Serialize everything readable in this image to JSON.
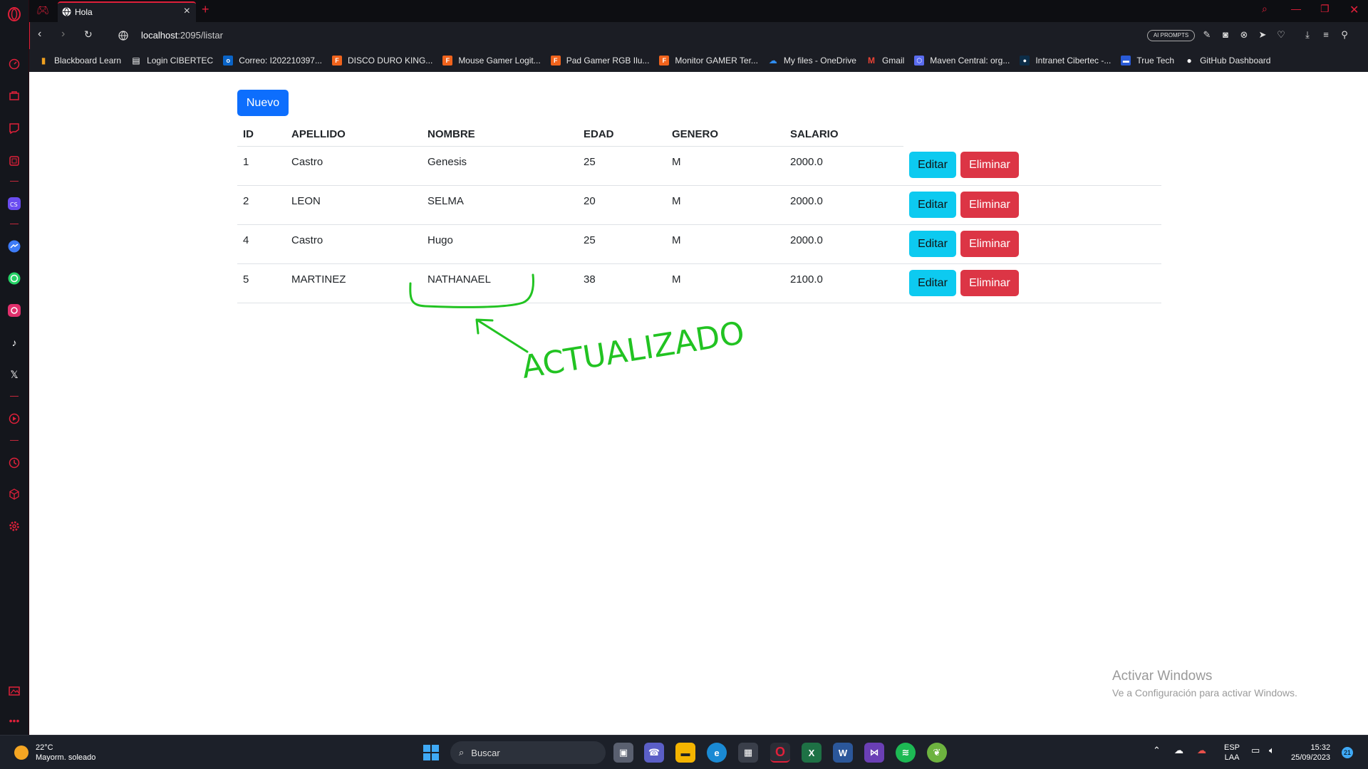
{
  "browser": {
    "tab_title": "Hola",
    "url_host": "localhost",
    "url_path": ":2095/listar",
    "ai_prompts_label": "AI PROMPTS",
    "accent_color": "#e0203a"
  },
  "bookmarks": [
    {
      "label": "Blackboard Learn",
      "icon": "bar-chart-icon",
      "color": "#f0a020"
    },
    {
      "label": "Login CIBERTEC",
      "icon": "document-icon",
      "color": "#ffffff"
    },
    {
      "label": "Correo: I202210397...",
      "icon": "outlook-icon",
      "color": "#0a64c8"
    },
    {
      "label": "DISCO DURO KING...",
      "icon": "falabella-icon",
      "color": "#f0631c"
    },
    {
      "label": "Mouse Gamer Logit...",
      "icon": "falabella-icon",
      "color": "#f0631c"
    },
    {
      "label": "Pad Gamer RGB Ilu...",
      "icon": "falabella-icon",
      "color": "#f0631c"
    },
    {
      "label": "Monitor GAMER Ter...",
      "icon": "falabella-icon",
      "color": "#f0631c"
    },
    {
      "label": "My files - OneDrive",
      "icon": "onedrive-icon",
      "color": "#2f8cf0"
    },
    {
      "label": "Gmail",
      "icon": "gmail-icon",
      "color": "#ea4335"
    },
    {
      "label": "Maven Central: org...",
      "icon": "maven-icon",
      "color": "#5a6cf0"
    },
    {
      "label": "Intranet Cibertec -...",
      "icon": "intranet-icon",
      "color": "#0c2d48"
    },
    {
      "label": "True Tech",
      "icon": "truetech-icon",
      "color": "#2a5bd7"
    },
    {
      "label": "GitHub Dashboard",
      "icon": "github-icon",
      "color": "#ffffff"
    }
  ],
  "page": {
    "new_button": "Nuevo",
    "columns": [
      "ID",
      "APELLIDO",
      "NOMBRE",
      "EDAD",
      "GENERO",
      "SALARIO"
    ],
    "rows": [
      {
        "id": "1",
        "apellido": "Castro",
        "nombre": "Genesis",
        "edad": "25",
        "genero": "M",
        "salario": "2000.0"
      },
      {
        "id": "2",
        "apellido": "LEON",
        "nombre": "SELMA",
        "edad": "20",
        "genero": "M",
        "salario": "2000.0"
      },
      {
        "id": "4",
        "apellido": "Castro",
        "nombre": "Hugo",
        "edad": "25",
        "genero": "M",
        "salario": "2000.0"
      },
      {
        "id": "5",
        "apellido": "MARTINEZ",
        "nombre": "NATHANAEL",
        "edad": "38",
        "genero": "M",
        "salario": "2100.0"
      }
    ],
    "edit_label": "Editar",
    "delete_label": "Eliminar",
    "annotation_text": "ACTUALIZADO",
    "annotation_color": "#22c322"
  },
  "watermark": {
    "title": "Activar Windows",
    "subtitle": "Ve a Configuración para activar Windows."
  },
  "taskbar": {
    "temperature": "22°C",
    "weather": "Mayorm. soleado",
    "search_placeholder": "Buscar",
    "lang_top": "ESP",
    "lang_bottom": "LAA",
    "time": "15:32",
    "date": "25/09/2023",
    "notifications": "21"
  }
}
